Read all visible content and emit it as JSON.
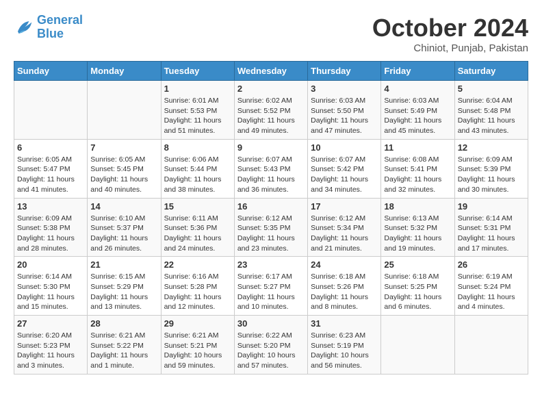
{
  "header": {
    "logo_line1": "General",
    "logo_line2": "Blue",
    "month": "October 2024",
    "location": "Chiniot, Punjab, Pakistan"
  },
  "weekdays": [
    "Sunday",
    "Monday",
    "Tuesday",
    "Wednesday",
    "Thursday",
    "Friday",
    "Saturday"
  ],
  "weeks": [
    [
      {
        "day": "",
        "info": ""
      },
      {
        "day": "",
        "info": ""
      },
      {
        "day": "1",
        "info": "Sunrise: 6:01 AM\nSunset: 5:53 PM\nDaylight: 11 hours and 51 minutes."
      },
      {
        "day": "2",
        "info": "Sunrise: 6:02 AM\nSunset: 5:52 PM\nDaylight: 11 hours and 49 minutes."
      },
      {
        "day": "3",
        "info": "Sunrise: 6:03 AM\nSunset: 5:50 PM\nDaylight: 11 hours and 47 minutes."
      },
      {
        "day": "4",
        "info": "Sunrise: 6:03 AM\nSunset: 5:49 PM\nDaylight: 11 hours and 45 minutes."
      },
      {
        "day": "5",
        "info": "Sunrise: 6:04 AM\nSunset: 5:48 PM\nDaylight: 11 hours and 43 minutes."
      }
    ],
    [
      {
        "day": "6",
        "info": "Sunrise: 6:05 AM\nSunset: 5:47 PM\nDaylight: 11 hours and 41 minutes."
      },
      {
        "day": "7",
        "info": "Sunrise: 6:05 AM\nSunset: 5:45 PM\nDaylight: 11 hours and 40 minutes."
      },
      {
        "day": "8",
        "info": "Sunrise: 6:06 AM\nSunset: 5:44 PM\nDaylight: 11 hours and 38 minutes."
      },
      {
        "day": "9",
        "info": "Sunrise: 6:07 AM\nSunset: 5:43 PM\nDaylight: 11 hours and 36 minutes."
      },
      {
        "day": "10",
        "info": "Sunrise: 6:07 AM\nSunset: 5:42 PM\nDaylight: 11 hours and 34 minutes."
      },
      {
        "day": "11",
        "info": "Sunrise: 6:08 AM\nSunset: 5:41 PM\nDaylight: 11 hours and 32 minutes."
      },
      {
        "day": "12",
        "info": "Sunrise: 6:09 AM\nSunset: 5:39 PM\nDaylight: 11 hours and 30 minutes."
      }
    ],
    [
      {
        "day": "13",
        "info": "Sunrise: 6:09 AM\nSunset: 5:38 PM\nDaylight: 11 hours and 28 minutes."
      },
      {
        "day": "14",
        "info": "Sunrise: 6:10 AM\nSunset: 5:37 PM\nDaylight: 11 hours and 26 minutes."
      },
      {
        "day": "15",
        "info": "Sunrise: 6:11 AM\nSunset: 5:36 PM\nDaylight: 11 hours and 24 minutes."
      },
      {
        "day": "16",
        "info": "Sunrise: 6:12 AM\nSunset: 5:35 PM\nDaylight: 11 hours and 23 minutes."
      },
      {
        "day": "17",
        "info": "Sunrise: 6:12 AM\nSunset: 5:34 PM\nDaylight: 11 hours and 21 minutes."
      },
      {
        "day": "18",
        "info": "Sunrise: 6:13 AM\nSunset: 5:32 PM\nDaylight: 11 hours and 19 minutes."
      },
      {
        "day": "19",
        "info": "Sunrise: 6:14 AM\nSunset: 5:31 PM\nDaylight: 11 hours and 17 minutes."
      }
    ],
    [
      {
        "day": "20",
        "info": "Sunrise: 6:14 AM\nSunset: 5:30 PM\nDaylight: 11 hours and 15 minutes."
      },
      {
        "day": "21",
        "info": "Sunrise: 6:15 AM\nSunset: 5:29 PM\nDaylight: 11 hours and 13 minutes."
      },
      {
        "day": "22",
        "info": "Sunrise: 6:16 AM\nSunset: 5:28 PM\nDaylight: 11 hours and 12 minutes."
      },
      {
        "day": "23",
        "info": "Sunrise: 6:17 AM\nSunset: 5:27 PM\nDaylight: 11 hours and 10 minutes."
      },
      {
        "day": "24",
        "info": "Sunrise: 6:18 AM\nSunset: 5:26 PM\nDaylight: 11 hours and 8 minutes."
      },
      {
        "day": "25",
        "info": "Sunrise: 6:18 AM\nSunset: 5:25 PM\nDaylight: 11 hours and 6 minutes."
      },
      {
        "day": "26",
        "info": "Sunrise: 6:19 AM\nSunset: 5:24 PM\nDaylight: 11 hours and 4 minutes."
      }
    ],
    [
      {
        "day": "27",
        "info": "Sunrise: 6:20 AM\nSunset: 5:23 PM\nDaylight: 11 hours and 3 minutes."
      },
      {
        "day": "28",
        "info": "Sunrise: 6:21 AM\nSunset: 5:22 PM\nDaylight: 11 hours and 1 minute."
      },
      {
        "day": "29",
        "info": "Sunrise: 6:21 AM\nSunset: 5:21 PM\nDaylight: 10 hours and 59 minutes."
      },
      {
        "day": "30",
        "info": "Sunrise: 6:22 AM\nSunset: 5:20 PM\nDaylight: 10 hours and 57 minutes."
      },
      {
        "day": "31",
        "info": "Sunrise: 6:23 AM\nSunset: 5:19 PM\nDaylight: 10 hours and 56 minutes."
      },
      {
        "day": "",
        "info": ""
      },
      {
        "day": "",
        "info": ""
      }
    ]
  ]
}
